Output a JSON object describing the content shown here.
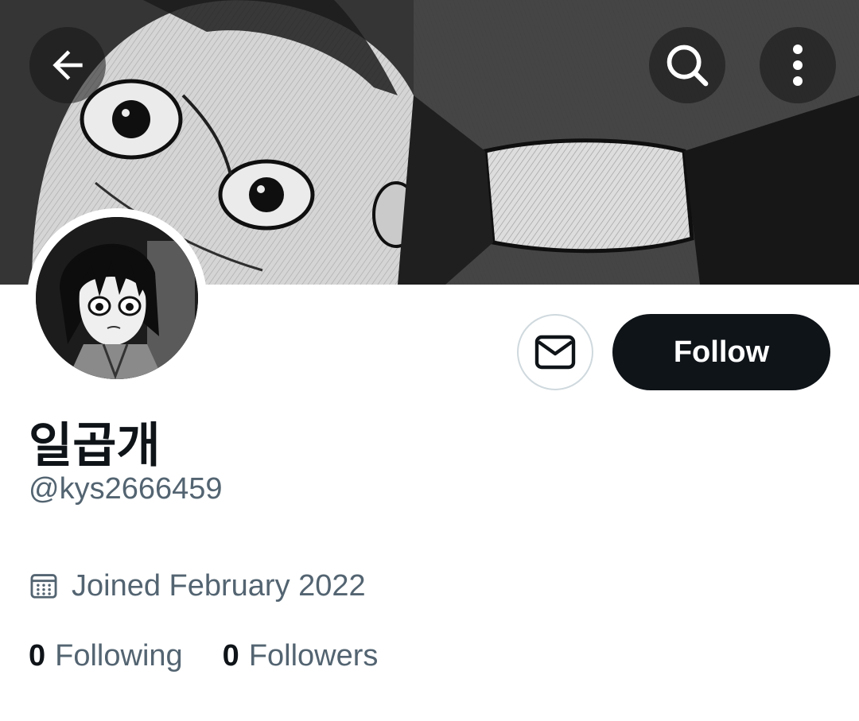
{
  "profile": {
    "display_name": "일곱개",
    "handle": "@kys2666459",
    "joined": "Joined February 2022"
  },
  "stats": {
    "following_count": "0",
    "following_label": "Following",
    "followers_count": "0",
    "followers_label": "Followers"
  },
  "actions": {
    "follow_label": "Follow"
  },
  "icons": {
    "back": "arrow-left-icon",
    "search": "search-icon",
    "more": "more-vertical-icon",
    "message": "envelope-icon",
    "calendar": "calendar-icon"
  },
  "colors": {
    "primary_text": "#0f1419",
    "secondary_text": "#536471",
    "button_border": "#cfd9de",
    "follow_bg": "#0f1419"
  }
}
